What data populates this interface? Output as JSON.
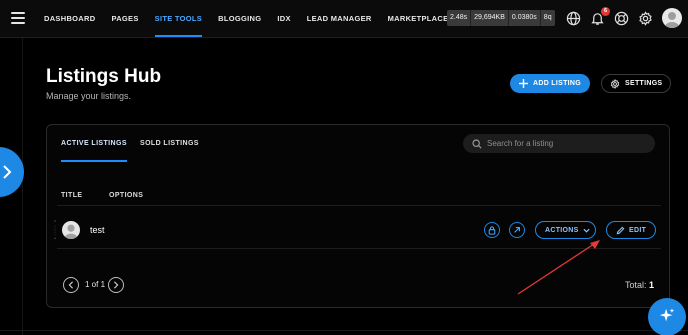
{
  "topbar": {
    "nav": [
      "DASHBOARD",
      "PAGES",
      "SITE TOOLS",
      "BLOGGING",
      "IDX",
      "LEAD MANAGER",
      "MARKETPLACE"
    ],
    "active_nav": "SITE TOOLS",
    "debug": [
      "2.48s",
      "29,694KB",
      "0.0380s",
      "8q"
    ],
    "notification_count": "6"
  },
  "header": {
    "title": "Listings Hub",
    "subtitle": "Manage your listings.",
    "add_label": "ADD LISTING",
    "settings_label": "SETTINGS"
  },
  "tabs": {
    "active": "ACTIVE LISTINGS",
    "sold": "SOLD LISTINGS"
  },
  "search": {
    "placeholder": "Search for a listing"
  },
  "table": {
    "columns": [
      "TITLE",
      "OPTIONS"
    ],
    "rows": [
      {
        "title": "test",
        "actions_label": "ACTIONS",
        "edit_label": "EDIT"
      }
    ]
  },
  "pagination": {
    "text": "1 of 1",
    "total_label": "Total:",
    "total_value": "1"
  },
  "colors": {
    "accent": "#1e88e5",
    "annotation": "#e53935",
    "background": "#000000"
  }
}
